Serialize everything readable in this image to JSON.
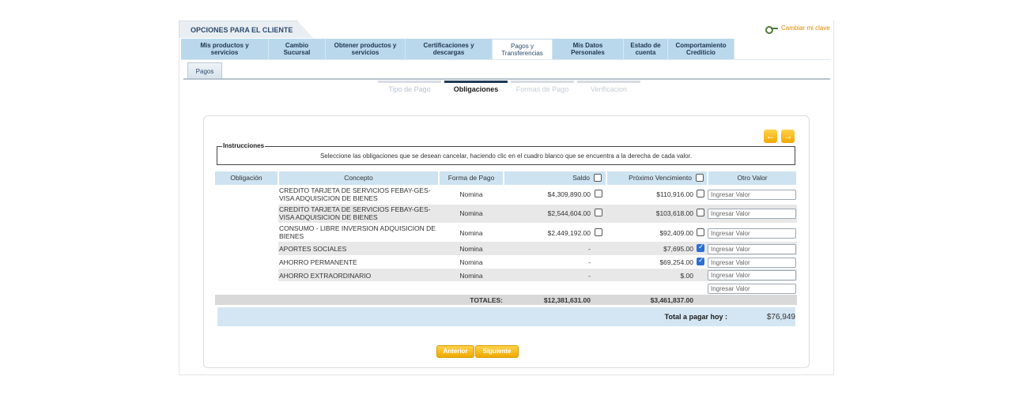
{
  "header": {
    "client_options": "OPCIONES PARA EL CLIENTE",
    "change_password": "Cambiar mi clave"
  },
  "nav": {
    "tabs": [
      {
        "line1": "Mis productos y",
        "line2": "servicios"
      },
      {
        "line1": "Cambio",
        "line2": "Sucursal"
      },
      {
        "line1": "Obtener productos y",
        "line2": "servicios"
      },
      {
        "line1": "Certificaciones y",
        "line2": "descargas"
      },
      {
        "line1": "Pagos y",
        "line2": "Transferencias"
      },
      {
        "line1": "Mis Datos",
        "line2": "Personales"
      },
      {
        "line1": "Estado de",
        "line2": "cuenta"
      },
      {
        "line1": "Comportamiento",
        "line2": "Crediticio"
      }
    ],
    "active_index": 4
  },
  "subtab": {
    "label": "Pagos"
  },
  "steps": [
    "Tipo de Pago",
    "Obligaciones",
    "Formas de Pago",
    "Verificacion"
  ],
  "instructions": {
    "legend": "Instrucciones",
    "text": "Seleccione las obligaciones que se desean cancelar, haciendo clic en el cuadro blanco que se encuentra a la derecha de cada valor."
  },
  "table": {
    "headers": {
      "obligacion": "Obligación",
      "concepto": "Concepto",
      "forma_pago": "Forma de Pago",
      "saldo": "Saldo",
      "proximo": "Próximo Vencimiento",
      "otro": "Otro Valor"
    },
    "input_placeholder": "Ingresar Valor",
    "rows": [
      {
        "concepto1": "CREDITO TARJETA DE SERVICIOS FEBAY-GES-",
        "concepto2": "VISA ADQUISICION DE BIENES",
        "forma": "Nomina",
        "saldo": "$4,309,890.00",
        "proximo": "$110,916.00"
      },
      {
        "concepto1": "CREDITO TARJETA DE SERVICIOS FEBAY-GES-",
        "concepto2": "VISA ADQUISICION DE BIENES",
        "forma": "Nomina",
        "saldo": "$2,544,604.00",
        "proximo": "$103,618.00"
      },
      {
        "concepto1": "CONSUMO - LIBRE INVERSION ADQUISICION DE",
        "concepto2": "BIENES",
        "forma": "Nomina",
        "saldo": "$2,449,192.00",
        "proximo": "$92,409.00"
      },
      {
        "concepto1": "APORTES SOCIALES",
        "concepto2": "",
        "forma": "Nomina",
        "saldo": "-",
        "proximo": "$7,695.00"
      },
      {
        "concepto1": "AHORRO PERMANENTE",
        "concepto2": "",
        "forma": "Nomina",
        "saldo": "-",
        "proximo": "$69,254.00"
      },
      {
        "concepto1": "AHORRO EXTRAORDINARIO",
        "concepto2": "",
        "forma": "Nomina",
        "saldo": "-",
        "proximo": "$.00"
      }
    ],
    "totals_label": "TOTALES:",
    "total_saldo": "$12,381,631.00",
    "total_proximo": "$3,461,837.00"
  },
  "total_pay": {
    "label": "Total a pagar hoy :",
    "value": "$76,949"
  },
  "buttons": {
    "prev": "Anterior",
    "next": "Siguiente"
  },
  "icons": {
    "prev_arrow": "←",
    "next_arrow": "→"
  },
  "colors": {
    "accent": "#f0a900",
    "header_bg": "#cde3f1",
    "nav_bg": "#b9d8ec",
    "link": "#e18a00"
  }
}
